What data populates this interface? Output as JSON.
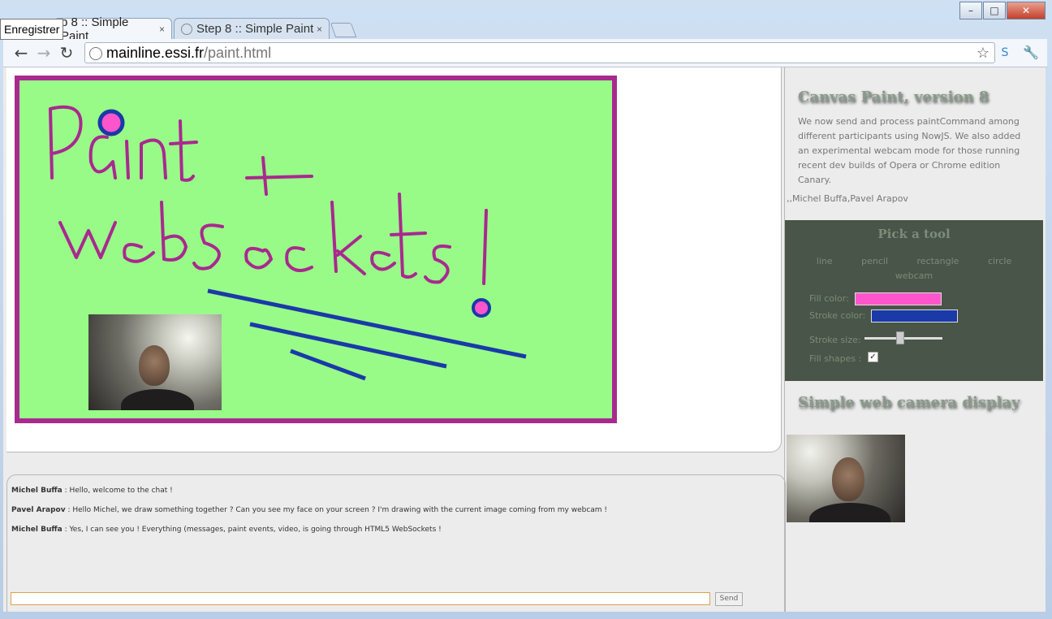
{
  "browser": {
    "tooltip": "Enregistrer",
    "tabs": [
      {
        "label": "p 8 :: Simple Paint",
        "close": "×"
      },
      {
        "label": "Step 8 :: Simple Paint",
        "close": "×"
      }
    ],
    "url_host": "mainline.essi.fr",
    "url_path": "/paint.html",
    "window_controls": {
      "minimize": "–",
      "maximize": "□",
      "close": "✕"
    }
  },
  "chat": {
    "messages": [
      {
        "author": "Michel Buffa",
        "text": " : Hello, welcome to the chat !"
      },
      {
        "author": "Pavel Arapov",
        "text": " : Hello Michel, we draw something together ? Can you see my face on your screen ? I'm drawing with the current image coming from my webcam !"
      },
      {
        "author": "Michel Buffa",
        "text": " : Yes, I can see you ! Everything (messages, paint events, video, is going through HTML5 WebSockets !"
      }
    ],
    "input_value": "",
    "send_label": "Send"
  },
  "sidebar": {
    "title": "Canvas Paint, version 8",
    "description": "We now send and process paintCommand among different participants using NowJS. We also added an experimental webcam mode for those running recent dev builds of Opera or Chrome edition Canary.",
    "authors": ",,Michel Buffa,Pavel Arapov",
    "toolbox": {
      "title": "Pick a tool",
      "tools": [
        "line",
        "pencil",
        "rectangle",
        "circle",
        "webcam"
      ],
      "fill_label": "Fill color:",
      "stroke_label": "Stroke color:",
      "stroke_size_label": "Stroke size:",
      "fill_shapes_label": "Fill shapes :",
      "fill_shapes_checked": "✓",
      "fill_color": "#ff55cc",
      "stroke_color": "#1a3aa8",
      "stroke_size": 0.45
    },
    "camera_title": "Simple web camera display"
  },
  "colors": {
    "canvas_bg": "#98fb88",
    "canvas_border": "#a9298f",
    "toolbox_bg": "#485548"
  }
}
